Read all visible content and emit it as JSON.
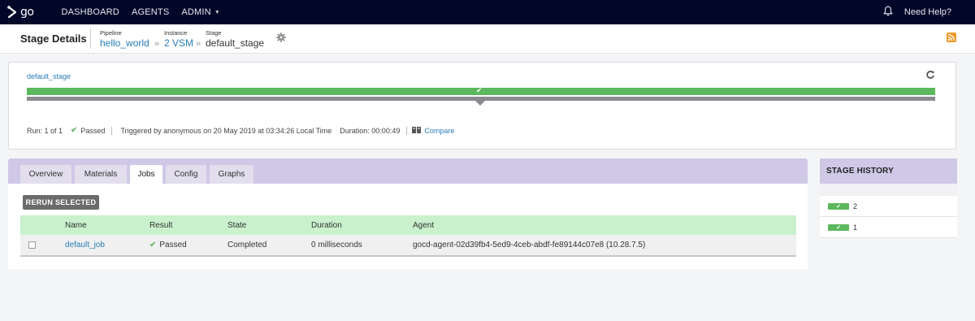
{
  "nav": {
    "logo_text": "go",
    "items": [
      {
        "label": "DASHBOARD"
      },
      {
        "label": "AGENTS"
      },
      {
        "label": "ADMIN"
      }
    ],
    "help": "Need Help?"
  },
  "header": {
    "title": "Stage Details",
    "breadcrumbs": [
      {
        "label": "Pipeline",
        "value": "hello_world"
      },
      {
        "label": "Instance",
        "value": "2 VSM"
      },
      {
        "label": "Stage",
        "value": "default_stage"
      }
    ]
  },
  "stage": {
    "name": "default_stage",
    "run": "Run: 1 of 1",
    "status": "Passed",
    "triggered": "Triggered by anonymous on 20 May 2019 at 03:34:26 Local Time",
    "duration": "Duration: 00:00:49",
    "compare": "Compare"
  },
  "tabs": [
    {
      "label": "Overview"
    },
    {
      "label": "Materials"
    },
    {
      "label": "Jobs"
    },
    {
      "label": "Config"
    },
    {
      "label": "Graphs"
    }
  ],
  "active_tab": "Jobs",
  "rerun_label": "RERUN SELECTED",
  "jobs": {
    "columns": [
      "Name",
      "Result",
      "State",
      "Duration",
      "Agent"
    ],
    "rows": [
      {
        "name": "default_job",
        "result": "Passed",
        "state": "Completed",
        "duration": "0 milliseconds",
        "agent": "gocd-agent-02d39fb4-5ed9-4ceb-abdf-fe89144c07e8 (10.28.7.5)"
      }
    ]
  },
  "history": {
    "title": "STAGE HISTORY",
    "items": [
      {
        "label": "2"
      },
      {
        "label": "1"
      }
    ]
  },
  "colors": {
    "nav_bg": "#000728",
    "accent_link": "#2a7db8",
    "passed_green": "#5cb85c",
    "tab_bar": "#cfc8e6",
    "table_header": "#c8f1cc"
  },
  "icons": [
    "go-logo-icon",
    "bell-icon",
    "gear-icon",
    "rss-icon",
    "refresh-icon",
    "check-icon",
    "compare-icon"
  ]
}
